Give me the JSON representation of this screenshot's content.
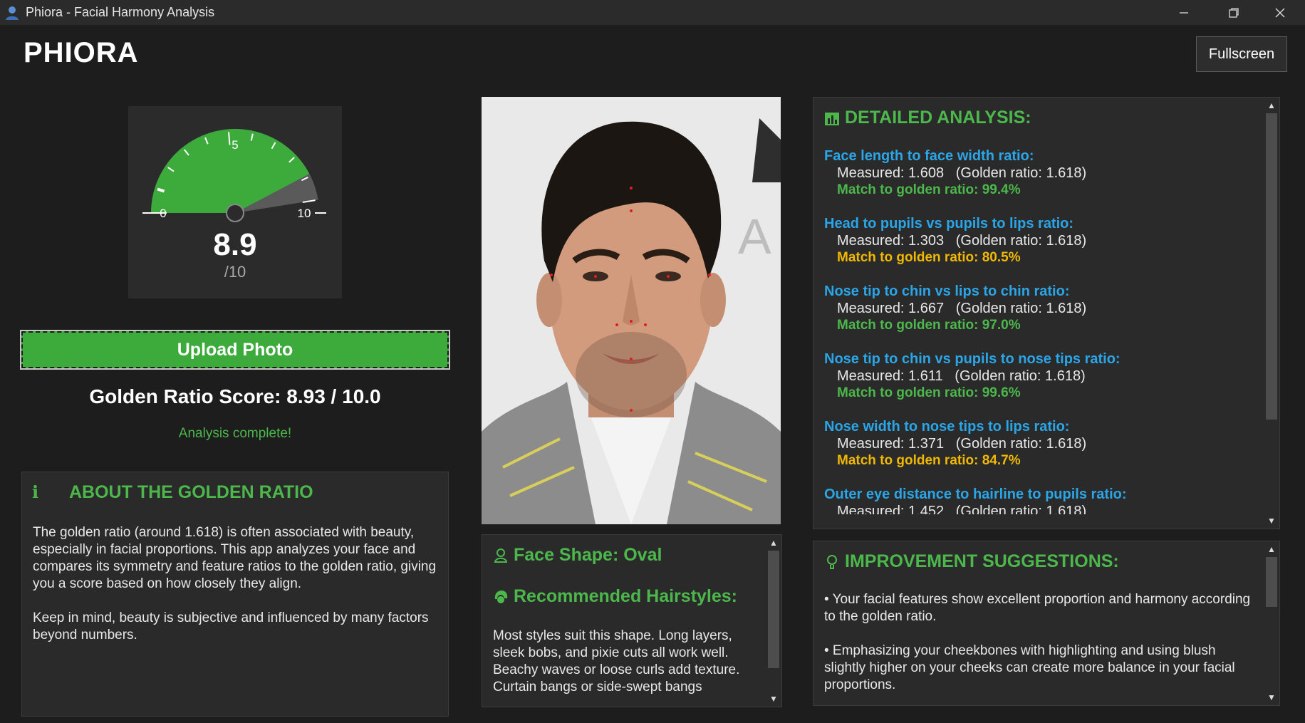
{
  "window": {
    "title": "Phiora - Facial Harmony Analysis",
    "minimize_icon": "minimize-icon",
    "maximize_icon": "restore-icon",
    "close_icon": "close-icon"
  },
  "header": {
    "brand": "PHIORA",
    "fullscreen_label": "Fullscreen"
  },
  "gauge": {
    "score": "8.9",
    "out_of": "/10",
    "value": 8.9,
    "max": 10,
    "tick_min": "0",
    "tick_mid": "5",
    "tick_max": "10",
    "fill_color": "#3cab3c"
  },
  "upload": {
    "label": "Upload Photo"
  },
  "result": {
    "golden_score": "Golden Ratio Score: 8.93 / 10.0",
    "status": "Analysis complete!"
  },
  "about": {
    "title": "ABOUT THE GOLDEN RATIO",
    "icon": "info-icon",
    "paragraphs": [
      "The golden ratio (around 1.618) is often associated with beauty, especially in facial proportions. This app analyzes your face and compares its symmetry and feature ratios to the golden ratio, giving you a score based on how closely they align.",
      "Keep in mind, beauty is subjective and influenced by many factors beyond numbers."
    ]
  },
  "face_shape": {
    "shape_title": "Face Shape: Oval",
    "hairstyles_title": "Recommended Hairstyles:",
    "body": "Most styles suit this shape. Long layers, sleek bobs, and pixie cuts all work well. Beachy waves or loose curls add texture. Curtain bangs or side-swept bangs"
  },
  "analysis": {
    "title": "DETAILED ANALYSIS:",
    "ratios": [
      {
        "name": "Face length to face width ratio:",
        "measured": "Measured: 1.608   (Golden ratio: 1.618)",
        "match": "Match to golden ratio: 99.4%",
        "match_color": "#4cb84c"
      },
      {
        "name": "Head to pupils vs pupils to lips ratio:",
        "measured": "Measured: 1.303   (Golden ratio: 1.618)",
        "match": "Match to golden ratio: 80.5%",
        "match_color": "#f0b800"
      },
      {
        "name": "Nose tip to chin vs lips to chin ratio:",
        "measured": "Measured: 1.667   (Golden ratio: 1.618)",
        "match": "Match to golden ratio: 97.0%",
        "match_color": "#4cb84c"
      },
      {
        "name": "Nose tip to chin vs pupils to nose tips ratio:",
        "measured": "Measured: 1.611   (Golden ratio: 1.618)",
        "match": "Match to golden ratio: 99.6%",
        "match_color": "#4cb84c"
      },
      {
        "name": "Nose width to nose tips to lips ratio:",
        "measured": "Measured: 1.371   (Golden ratio: 1.618)",
        "match": "Match to golden ratio: 84.7%",
        "match_color": "#f0b800"
      },
      {
        "name": "Outer eye distance to hairline to pupils ratio:",
        "measured": "Measured: 1.452   (Golden ratio: 1.618)",
        "match": "",
        "match_color": "#4cb84c"
      }
    ]
  },
  "improvements": {
    "title": "IMPROVEMENT SUGGESTIONS:",
    "items": [
      "• Your facial features show excellent proportion and harmony according to the golden ratio.",
      "• Emphasizing your cheekbones with highlighting and using blush slightly higher on your cheeks can create more balance in your facial proportions."
    ]
  }
}
